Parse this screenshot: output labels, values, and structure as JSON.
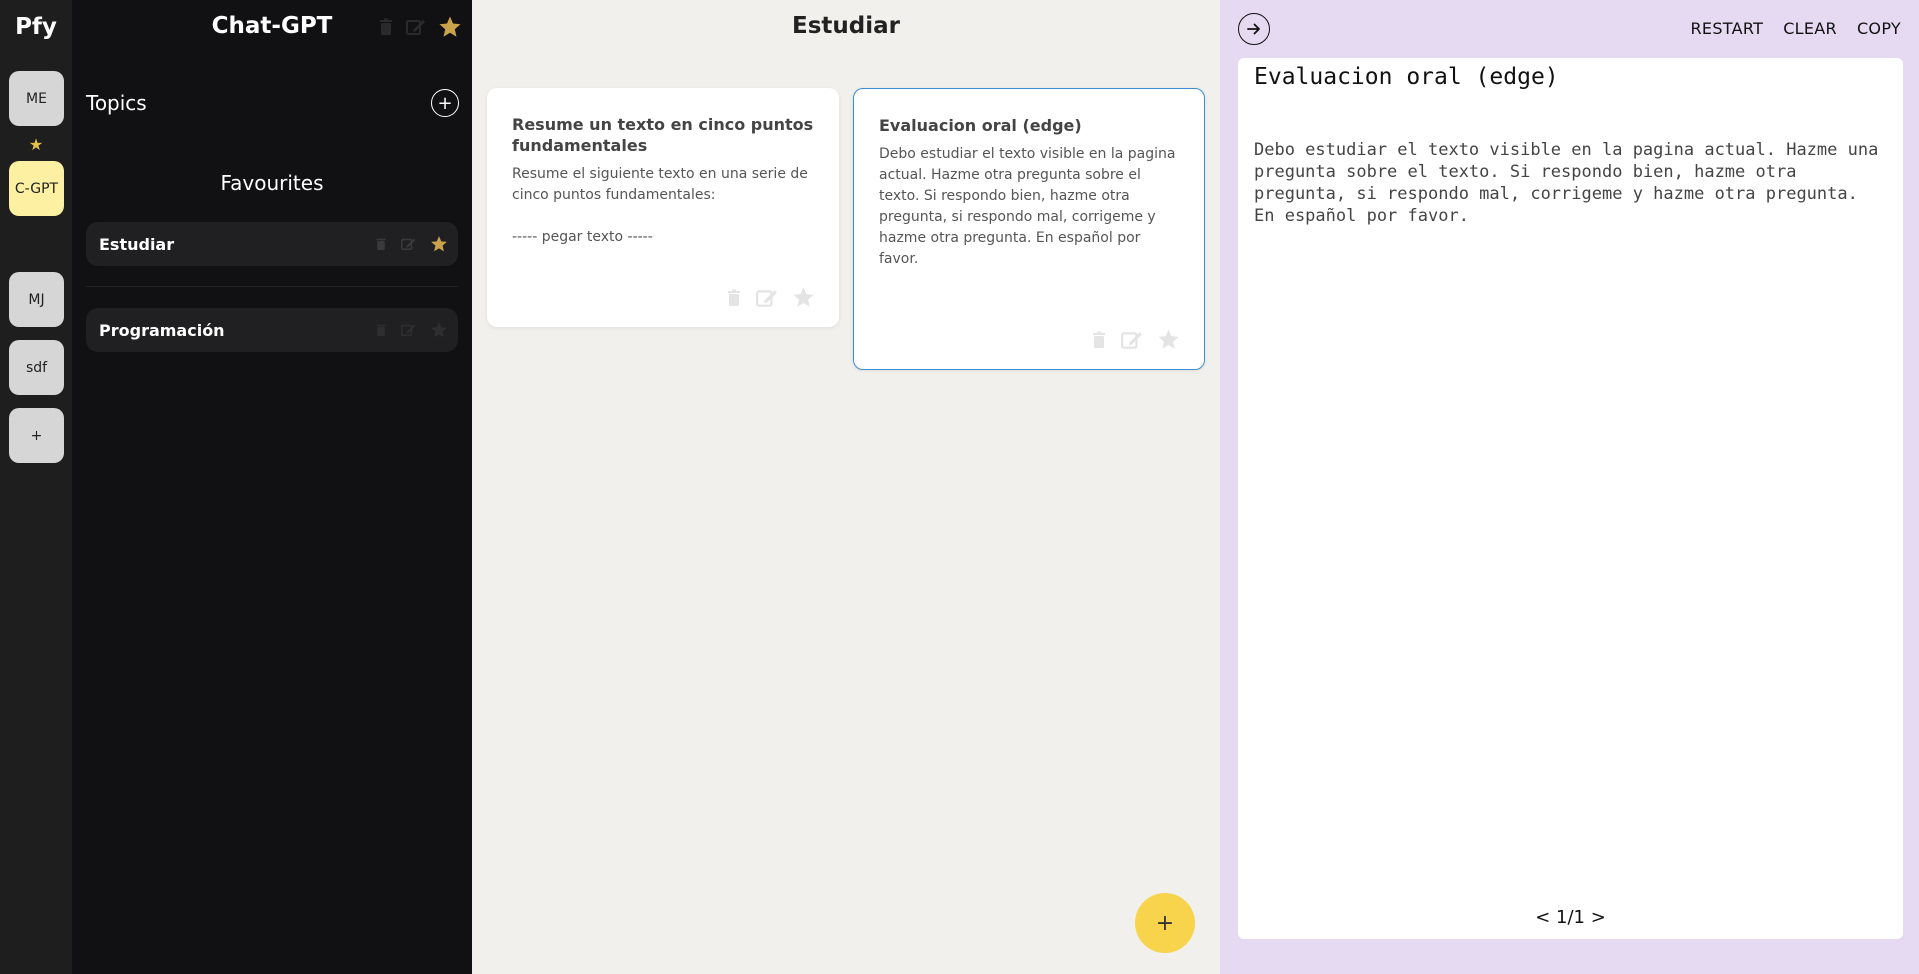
{
  "app": {
    "logo": "Pfy"
  },
  "rail": {
    "items": [
      "ME",
      "C-GPT",
      "MJ",
      "sdf",
      "+"
    ]
  },
  "topics_panel": {
    "title": "Chat-GPT",
    "section_title": "Topics",
    "favourites_title": "Favourites",
    "items": [
      {
        "label": "Estudiar",
        "starred": true
      },
      {
        "label": "Programación",
        "starred": false
      }
    ]
  },
  "prompts_panel": {
    "title": "Estudiar",
    "cards": [
      {
        "title": "Resume un texto en cinco puntos fundamentales",
        "body": "Resume el siguiente texto en una serie de cinco puntos fundamentales:\n\n----- pegar texto -----"
      },
      {
        "title": "Evaluacion oral (edge)",
        "body": "Debo estudiar el texto visible en la pagina actual. Hazme otra pregunta sobre el texto. Si respondo bien, hazme otra pregunta, si respondo mal, corrigeme y hazme otra pregunta. En español por favor."
      }
    ],
    "fab_label": "+"
  },
  "output_panel": {
    "actions": [
      "RESTART",
      "CLEAR",
      "COPY"
    ],
    "title": "Evaluacion oral (edge)",
    "body": "Debo estudiar el texto visible en la pagina actual. Hazme una pregunta sobre el texto. Si respondo bien, hazme otra pregunta, si respondo mal, corrigeme y hazme otra pregunta. En español por favor.",
    "pager": "< 1/1 >"
  },
  "colors": {
    "rail_bg": "#1e1e1e",
    "topics_bg": "#111114",
    "middle_bg": "#f2f0ec",
    "right_bg": "#e6daf2",
    "accent_star": "#e7c04b",
    "fab": "#f7d44c",
    "selected_border": "#3a8fd6",
    "active_pill": "#fdf0a3"
  }
}
